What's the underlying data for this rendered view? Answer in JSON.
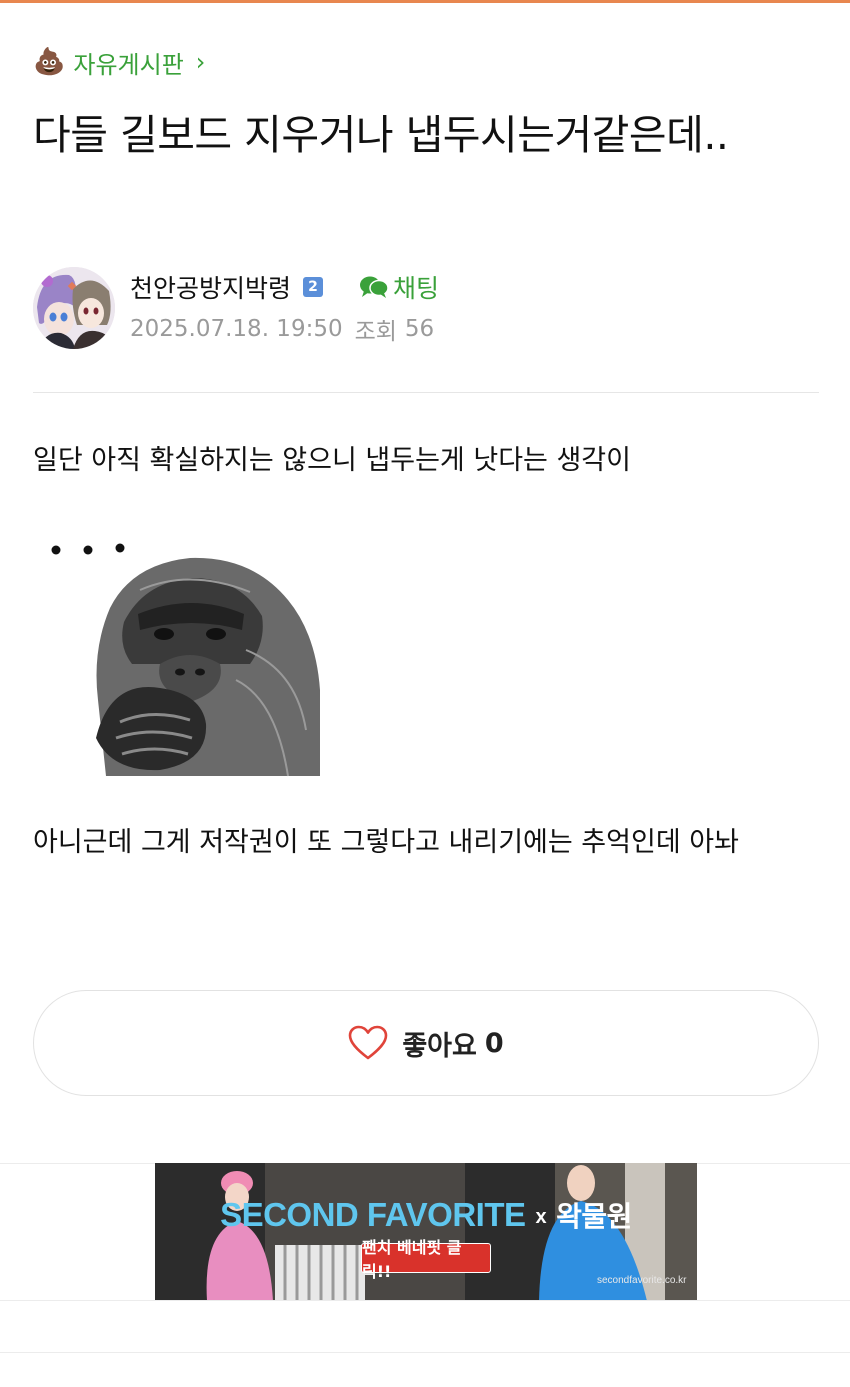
{
  "theme": {
    "accent": "#e8874f",
    "green": "#3aa13a",
    "muted": "#9a9a9a",
    "badge": "#5b8fd9",
    "heart": "#e0443a"
  },
  "board": {
    "icon": "poop-icon",
    "emoji": "💩",
    "label": "자유게시판",
    "chevron": "›"
  },
  "post": {
    "title": "다들 길보드 지우거나 냅두시는거같은데..",
    "author": "천안공방지박령",
    "level": "2",
    "chat_label": "채팅",
    "date": "2025.07.18. 19:50",
    "views_label": "조회",
    "views": "56",
    "body_1": "일단 아직 확실하지는 않으니 냅두는게 낫다는 생각이",
    "ellipsis": "• • •",
    "body_2": "아니근데 그게 저작권이 또 그렇다고 내리기에는 추억인데 아놔"
  },
  "like": {
    "label": "좋아요",
    "count": "0"
  },
  "ad": {
    "brand": "SECOND FAVORITE",
    "x": "x",
    "partner": "왁물원",
    "cta": "팬치 베네핏 클릭!!",
    "url": "secondfavorite.co.kr"
  }
}
